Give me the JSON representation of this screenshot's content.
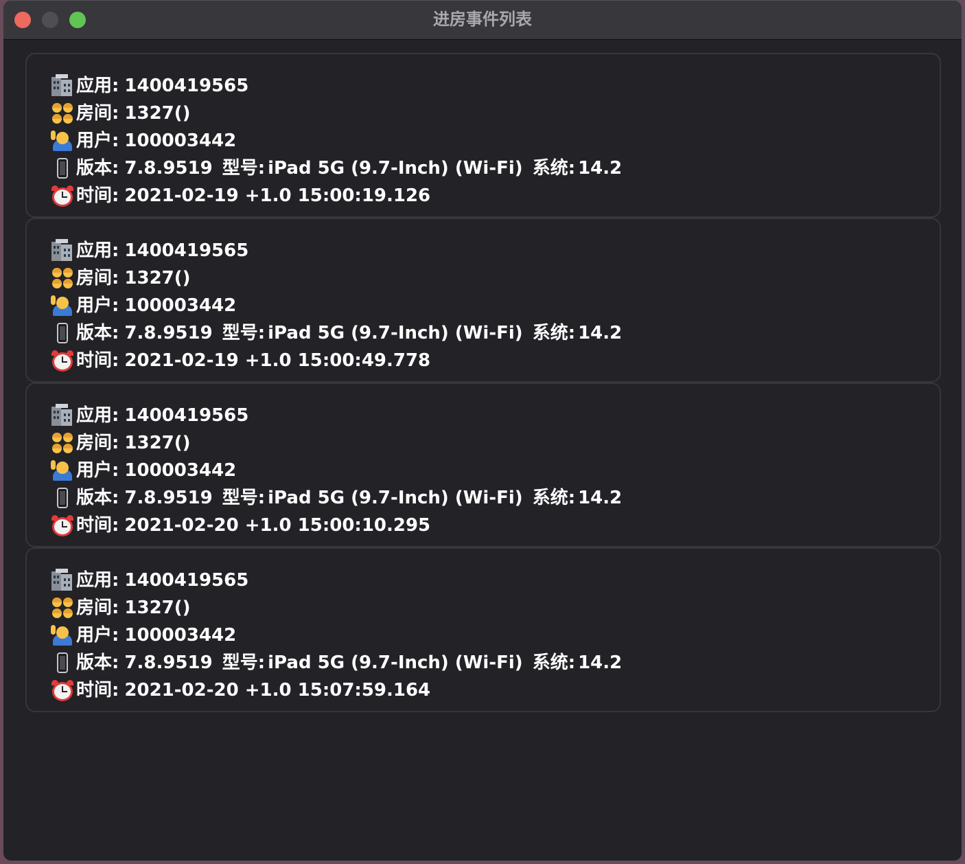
{
  "window": {
    "title": "进房事件列表"
  },
  "labels": {
    "app": "应用:",
    "room": "房间:",
    "user": "用户:",
    "version": "版本:",
    "model": "型号:",
    "system": "系统:",
    "time": "时间:"
  },
  "icons": {
    "app": "office-building-icon",
    "room": "family-icon",
    "user": "person-raising-hand-icon",
    "version": "mobile-phone-icon",
    "time": "alarm-clock-icon"
  },
  "events": [
    {
      "app": "1400419565",
      "room": "1327()",
      "user": "100003442",
      "version": "7.8.9519",
      "model": "iPad 5G (9.7-Inch) (Wi-Fi)",
      "system": "14.2",
      "time": "2021-02-19 +1.0 15:00:19.126"
    },
    {
      "app": "1400419565",
      "room": "1327()",
      "user": "100003442",
      "version": "7.8.9519",
      "model": "iPad 5G (9.7-Inch) (Wi-Fi)",
      "system": "14.2",
      "time": "2021-02-19 +1.0 15:00:49.778"
    },
    {
      "app": "1400419565",
      "room": "1327()",
      "user": "100003442",
      "version": "7.8.9519",
      "model": "iPad 5G (9.7-Inch) (Wi-Fi)",
      "system": "14.2",
      "time": "2021-02-20 +1.0 15:00:10.295"
    },
    {
      "app": "1400419565",
      "room": "1327()",
      "user": "100003442",
      "version": "7.8.9519",
      "model": "iPad 5G (9.7-Inch) (Wi-Fi)",
      "system": "14.2",
      "time": "2021-02-20 +1.0 15:07:59.164"
    }
  ],
  "colors": {
    "close": "#ed6a5e",
    "minimize_inactive": "#4f4e53",
    "zoom": "#61c454",
    "window_bg": "#232227",
    "card_border": "#37363b",
    "text": "#ffffff",
    "title_text": "#a9a8ad"
  }
}
